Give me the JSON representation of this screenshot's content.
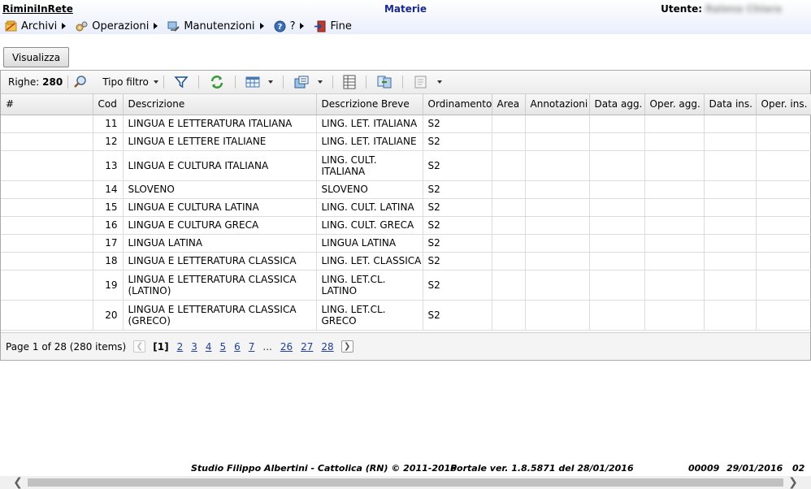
{
  "header": {
    "brand": "RiminiInRete",
    "title": "Materie",
    "user_label": "Utente:",
    "user_name": "Ralena Chiara"
  },
  "menu": [
    {
      "label": "Archivi",
      "icon": "archive-icon"
    },
    {
      "label": "Operazioni",
      "icon": "gears-icon"
    },
    {
      "label": "Manutenzioni",
      "icon": "wrench-pc-icon"
    },
    {
      "label": "?",
      "icon": "help-icon"
    },
    {
      "label": "Fine",
      "icon": "exit-icon"
    }
  ],
  "visualizza_label": "Visualizza",
  "toolbar": {
    "rows_label": "Righe:",
    "rows_count": "280",
    "filter_type_label": "Tipo filtro"
  },
  "table": {
    "columns": [
      "#",
      "Cod",
      "Descrizione",
      "Descrizione Breve",
      "Ordinamento",
      "Area",
      "Annotazioni",
      "Data agg.",
      "Oper. agg.",
      "Data ins.",
      "Oper. ins."
    ],
    "rows": [
      {
        "cod": "11",
        "descr": "LINGUA E LETTERATURA ITALIANA",
        "breve": "LING. LET. ITALIANA",
        "ord": "S2"
      },
      {
        "cod": "12",
        "descr": "LINGUA E LETTERE ITALIANE",
        "breve": "LING. LET. ITALIANE",
        "ord": "S2"
      },
      {
        "cod": "13",
        "descr": "LINGUA E CULTURA ITALIANA",
        "breve": "LING. CULT. ITALIANA",
        "ord": "S2"
      },
      {
        "cod": "14",
        "descr": "SLOVENO",
        "breve": "SLOVENO",
        "ord": "S2"
      },
      {
        "cod": "15",
        "descr": "LINGUA E CULTURA LATINA",
        "breve": "LING. CULT. LATINA",
        "ord": "S2"
      },
      {
        "cod": "16",
        "descr": "LINGUA E CULTURA GRECA",
        "breve": "LING. CULT. GRECA",
        "ord": "S2"
      },
      {
        "cod": "17",
        "descr": "LINGUA LATINA",
        "breve": "LINGUA LATINA",
        "ord": "S2"
      },
      {
        "cod": "18",
        "descr": "LINGUA E LETTERATURA CLASSICA",
        "breve": "LING. LET. CLASSICA",
        "ord": "S2"
      },
      {
        "cod": "19",
        "descr": "LINGUA E LETTERATURA CLASSICA (LATINO)",
        "breve": "LING. LET.CL. LATINO",
        "ord": "S2"
      },
      {
        "cod": "20",
        "descr": "LINGUA E LETTERATURA CLASSICA (GRECO)",
        "breve": "LING. LET.CL. GRECO",
        "ord": "S2"
      }
    ]
  },
  "pager": {
    "info": "Page 1 of 28 (280 items)",
    "current": "[1]",
    "pages": [
      "2",
      "3",
      "4",
      "5",
      "6",
      "7"
    ],
    "ellipsis": "...",
    "last_pages": [
      "26",
      "27",
      "28"
    ]
  },
  "footer": {
    "studio": "Studio Filippo Albertini - Cattolica (RN) © 2011-2016",
    "version": "Portale ver. 1.8.5871 del 28/01/2016",
    "code": "00009",
    "date": "29/01/2016",
    "suffix": "02"
  }
}
